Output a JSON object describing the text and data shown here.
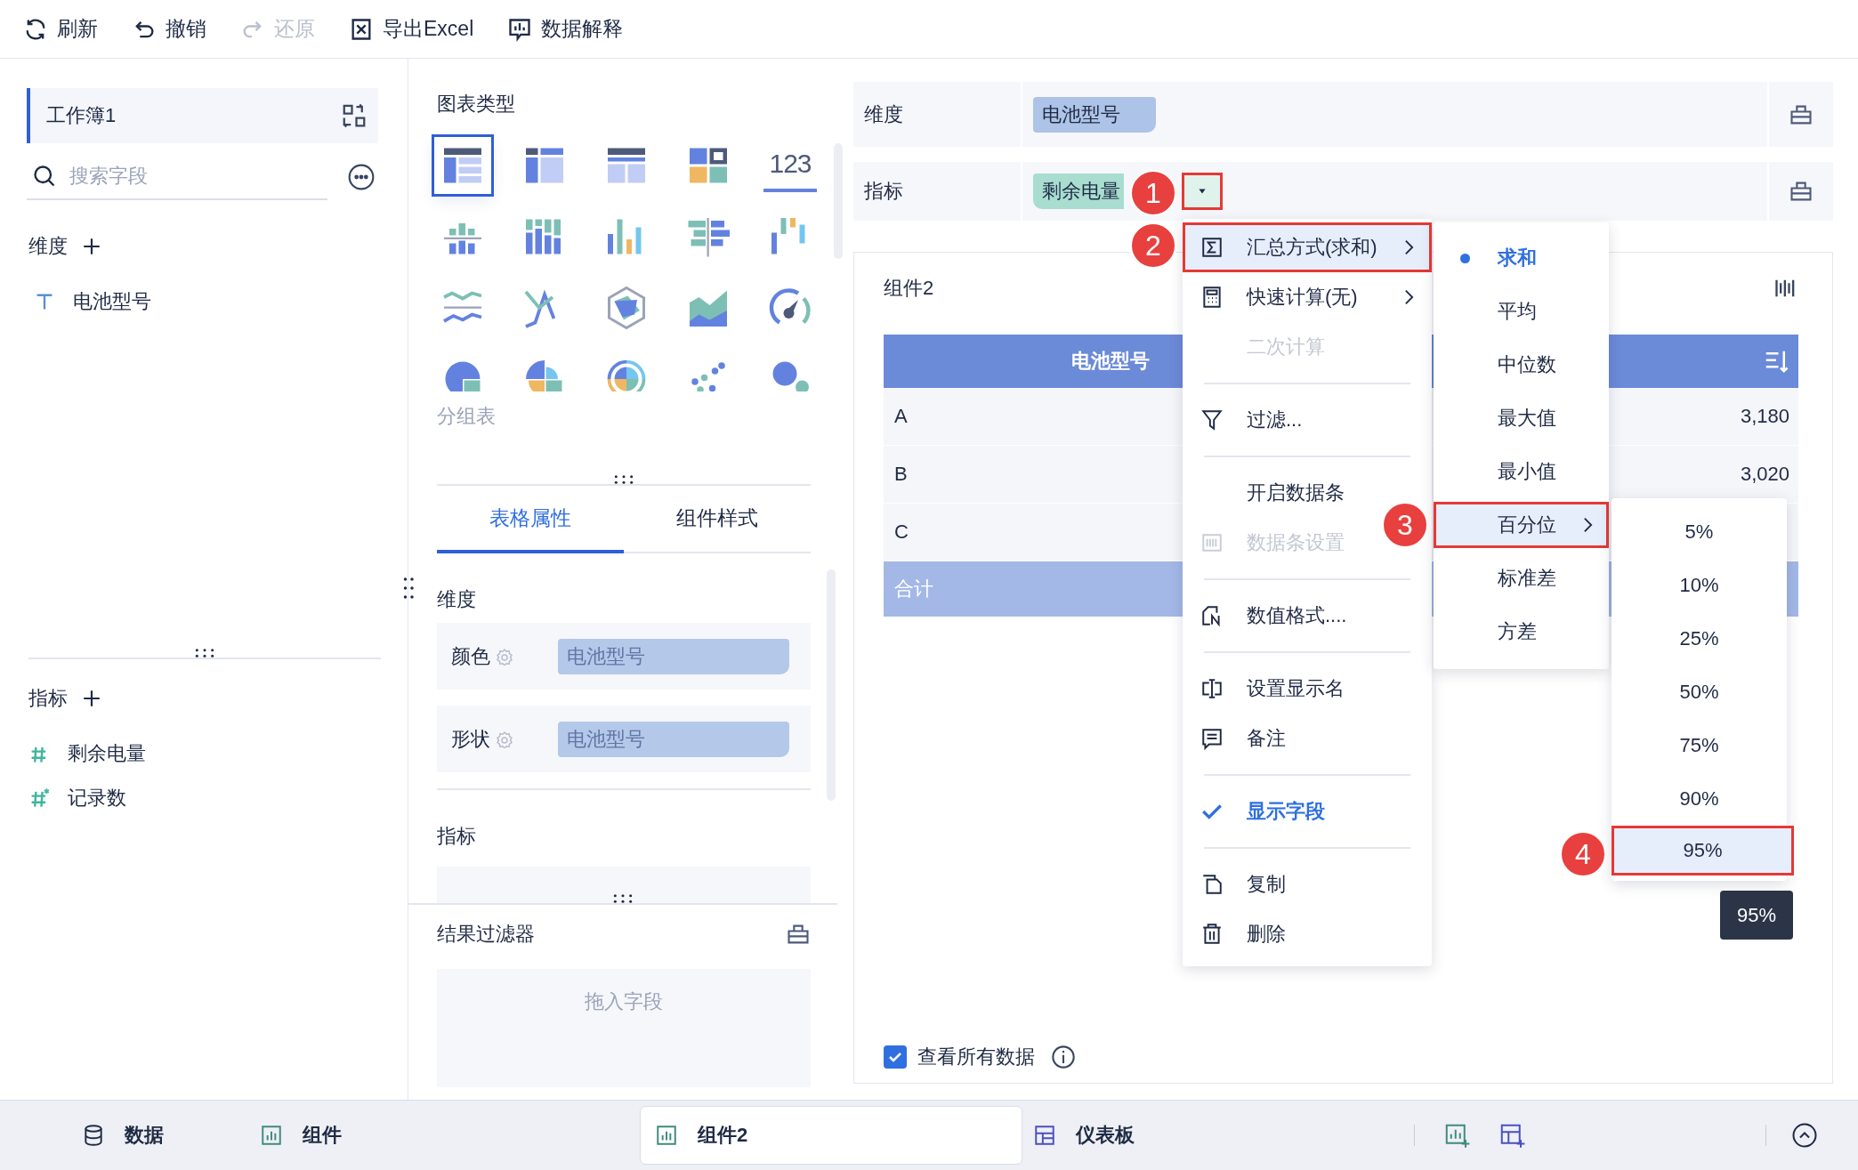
{
  "toolbar": [
    {
      "kind": "refresh",
      "label": "刷新",
      "disabled": false
    },
    {
      "kind": "undo",
      "label": "撤销",
      "disabled": false
    },
    {
      "kind": "redo",
      "label": "还原",
      "disabled": true
    },
    {
      "kind": "export",
      "label": "导出Excel",
      "disabled": false
    },
    {
      "kind": "explain",
      "label": "数据解释",
      "disabled": false
    }
  ],
  "data_panel": {
    "workbook": "工作簿1",
    "search": {
      "placeholder": "搜索字段"
    },
    "dimensions": {
      "title": "维度",
      "fields": [
        {
          "label": "电池型号",
          "kind": "text"
        }
      ]
    },
    "measures": {
      "title": "指标",
      "fields": [
        {
          "label": "剩余电量",
          "kind": "number"
        },
        {
          "label": "记录数",
          "kind": "count"
        }
      ]
    }
  },
  "chart_panel": {
    "title": "图表类型",
    "chart_types": [
      {
        "kind": "detail-table",
        "selected": true
      },
      {
        "kind": "cross-table",
        "selected": false
      },
      {
        "kind": "group-table",
        "selected": false
      },
      {
        "kind": "card-table",
        "selected": false
      },
      {
        "kind": "kpi",
        "text": "123",
        "selected": false
      },
      {
        "kind": "diverging-bar",
        "selected": false
      },
      {
        "kind": "stacked-column",
        "selected": false
      },
      {
        "kind": "column",
        "selected": false
      },
      {
        "kind": "compare-bar",
        "selected": false
      },
      {
        "kind": "waterfall",
        "selected": false
      },
      {
        "kind": "line-band",
        "selected": false
      },
      {
        "kind": "line",
        "selected": false
      },
      {
        "kind": "radar",
        "selected": false
      },
      {
        "kind": "area",
        "selected": false
      },
      {
        "kind": "gauge",
        "selected": false
      },
      {
        "kind": "pie",
        "selected": false
      },
      {
        "kind": "rose",
        "selected": false
      },
      {
        "kind": "sunburst",
        "selected": false
      },
      {
        "kind": "scatter",
        "selected": false
      },
      {
        "kind": "bubble",
        "selected": false
      }
    ],
    "hover_label": "分组表",
    "tabs": [
      {
        "label": "表格属性",
        "selected": true
      },
      {
        "label": "组件样式",
        "selected": false
      }
    ],
    "dimension_section": {
      "title": "维度",
      "rows": [
        {
          "label": "颜色",
          "value": "电池型号"
        },
        {
          "label": "形状",
          "value": "电池型号"
        }
      ]
    },
    "measure_section": {
      "title": "指标"
    },
    "result_filter": {
      "title": "结果过滤器",
      "placeholder": "拖入字段"
    }
  },
  "shelves": [
    {
      "label": "维度",
      "pills": [
        {
          "text": "电池型号",
          "kind": "dimension"
        }
      ]
    },
    {
      "label": "指标",
      "pills": [
        {
          "text": "剩余电量",
          "kind": "measure",
          "has_dropdown": true,
          "highlighted": true
        }
      ]
    }
  ],
  "component": {
    "title": "组件2",
    "table": {
      "columns": [
        "电池型号"
      ],
      "rows": [
        {
          "label": "A",
          "value": "3,180"
        },
        {
          "label": "B",
          "value": "3,020"
        },
        {
          "label": "C"
        }
      ],
      "total": "合计"
    },
    "show_all": {
      "label": "查看所有数据",
      "checked": true
    }
  },
  "context_menu": [
    {
      "kind": "sum",
      "label": "汇总方式(求和)",
      "submenu": true,
      "disabled": false,
      "checked": false,
      "highlighted": true
    },
    {
      "kind": "calculator",
      "label": "快速计算(无)",
      "submenu": true,
      "disabled": false,
      "checked": false,
      "highlighted": false
    },
    {
      "kind": "plain",
      "label": "二次计算",
      "submenu": false,
      "disabled": true,
      "checked": false,
      "highlighted": false
    },
    {
      "kind": "separator"
    },
    {
      "kind": "filter",
      "label": "过滤...",
      "submenu": false,
      "disabled": false,
      "checked": false,
      "highlighted": false
    },
    {
      "kind": "separator"
    },
    {
      "kind": "plain",
      "label": "开启数据条",
      "submenu": false,
      "disabled": false,
      "checked": false,
      "highlighted": false
    },
    {
      "kind": "databar",
      "label": "数据条设置",
      "submenu": false,
      "disabled": true,
      "checked": false,
      "highlighted": false
    },
    {
      "kind": "separator"
    },
    {
      "kind": "format",
      "label": "数值格式....",
      "submenu": false,
      "disabled": false,
      "checked": false,
      "highlighted": false
    },
    {
      "kind": "separator"
    },
    {
      "kind": "rename",
      "label": "设置显示名",
      "submenu": false,
      "disabled": false,
      "checked": false,
      "highlighted": false
    },
    {
      "kind": "note",
      "label": "备注",
      "submenu": false,
      "disabled": false,
      "checked": false,
      "highlighted": false
    },
    {
      "kind": "separator"
    },
    {
      "kind": "plain",
      "label": "显示字段",
      "submenu": false,
      "disabled": false,
      "checked": true,
      "highlighted": false
    },
    {
      "kind": "separator"
    },
    {
      "kind": "copy",
      "label": "复制",
      "submenu": false,
      "disabled": false,
      "checked": false,
      "highlighted": false
    },
    {
      "kind": "delete",
      "label": "删除",
      "submenu": false,
      "disabled": false,
      "checked": false,
      "highlighted": false
    }
  ],
  "aggregation_menu": [
    {
      "label": "求和",
      "selected": true,
      "submenu": false,
      "highlighted": false
    },
    {
      "label": "平均",
      "selected": false,
      "submenu": false,
      "highlighted": false
    },
    {
      "label": "中位数",
      "selected": false,
      "submenu": false,
      "highlighted": false
    },
    {
      "label": "最大值",
      "selected": false,
      "submenu": false,
      "highlighted": false
    },
    {
      "label": "最小值",
      "selected": false,
      "submenu": false,
      "highlighted": false
    },
    {
      "label": "百分位",
      "selected": false,
      "submenu": true,
      "highlighted": true
    },
    {
      "label": "标准差",
      "selected": false,
      "submenu": false,
      "highlighted": false
    },
    {
      "label": "方差",
      "selected": false,
      "submenu": false,
      "highlighted": false
    }
  ],
  "percentile_menu": [
    {
      "label": "5%",
      "highlighted": false
    },
    {
      "label": "10%",
      "highlighted": false
    },
    {
      "label": "25%",
      "highlighted": false
    },
    {
      "label": "50%",
      "highlighted": false
    },
    {
      "label": "75%",
      "highlighted": false
    },
    {
      "label": "90%",
      "highlighted": false
    },
    {
      "label": "95%",
      "highlighted": true
    }
  ],
  "tooltip": "95%",
  "callouts": [
    "1",
    "2",
    "3",
    "4"
  ],
  "bottom_tabs": [
    {
      "kind": "database",
      "label": "数据",
      "selected": false
    },
    {
      "kind": "chart",
      "label": "组件",
      "selected": false
    },
    {
      "kind": "chart",
      "label": "组件2",
      "selected": true
    },
    {
      "kind": "dashboard",
      "label": "仪表板",
      "selected": false
    }
  ]
}
